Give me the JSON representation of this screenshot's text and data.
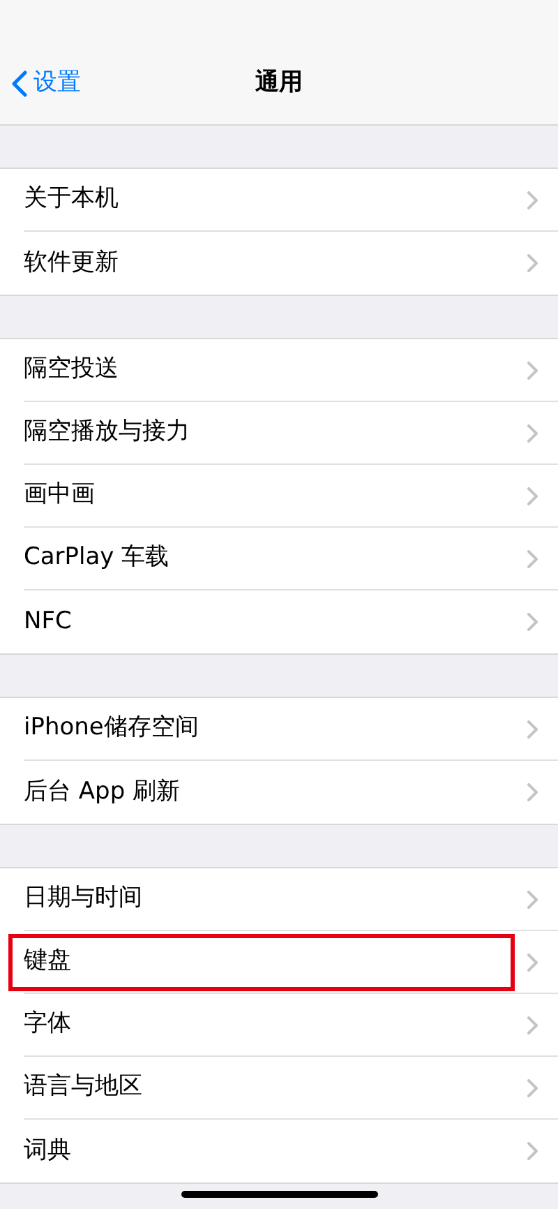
{
  "nav": {
    "back": "设置",
    "title": "通用"
  },
  "groups": [
    {
      "rows": [
        {
          "label": "关于本机",
          "highlighted": false
        },
        {
          "label": "软件更新",
          "highlighted": false
        }
      ]
    },
    {
      "rows": [
        {
          "label": "隔空投送",
          "highlighted": false
        },
        {
          "label": "隔空播放与接力",
          "highlighted": false
        },
        {
          "label": "画中画",
          "highlighted": false
        },
        {
          "label": "CarPlay 车载",
          "highlighted": false
        },
        {
          "label": "NFC",
          "highlighted": false
        }
      ]
    },
    {
      "rows": [
        {
          "label": "iPhone储存空间",
          "highlighted": false
        },
        {
          "label": "后台 App 刷新",
          "highlighted": false
        }
      ]
    },
    {
      "rows": [
        {
          "label": "日期与时间",
          "highlighted": false
        },
        {
          "label": "键盘",
          "highlighted": true
        },
        {
          "label": "字体",
          "highlighted": false
        },
        {
          "label": "语言与地区",
          "highlighted": false
        },
        {
          "label": "词典",
          "highlighted": false
        }
      ]
    }
  ]
}
